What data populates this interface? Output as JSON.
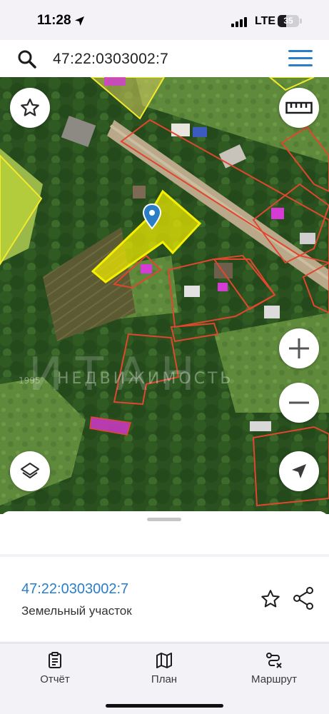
{
  "status_bar": {
    "time": "11:28",
    "network": "LTE",
    "battery": "35"
  },
  "search": {
    "query": "47:22:0303002:7",
    "icon": "search-icon",
    "menu_icon": "hamburger-menu-icon"
  },
  "map": {
    "watermark": "ИТАН",
    "watermark_sub": "НЕДВИЖИМОСТЬ",
    "watermark_year": "1995",
    "buttons": {
      "favorite": "star-icon",
      "ruler": "ruler-icon",
      "zoom_in": "plus-icon",
      "zoom_out": "minus-icon",
      "layers": "layers-icon",
      "locate": "location-arrow-icon"
    },
    "colors": {
      "selected_parcel": "#f5ef00",
      "parcel_border": "#e0472e",
      "building": "#d63bd6",
      "marker": "#2a7ec8"
    }
  },
  "parcel": {
    "id": "47:22:0303002:7",
    "type": "Земельный участок"
  },
  "tabs": [
    {
      "label": "Отчёт",
      "icon": "report-icon"
    },
    {
      "label": "План",
      "icon": "map-plan-icon"
    },
    {
      "label": "Маршрут",
      "icon": "route-icon"
    }
  ]
}
